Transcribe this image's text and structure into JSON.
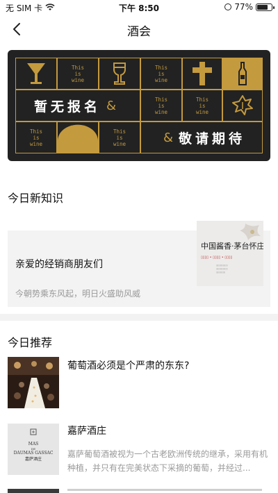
{
  "status_bar": {
    "carrier": "无 SIM 卡",
    "time": "下午 8:50",
    "battery_text": "77%",
    "battery_level": 0.77
  },
  "nav": {
    "title": "酒会"
  },
  "banner": {
    "wine_text": "This\nis\nwine",
    "left_text": "暂无报名",
    "right_text": "敬请期待",
    "amp": "&",
    "gold": "#c49a3e",
    "bg": "#222222"
  },
  "knowledge": {
    "section_title": "今日新知识",
    "card": {
      "headline": "亲爱的经销商朋友们",
      "subtitle": "今朝势乘东风起，明日火盛助风威",
      "thumb_title": "中国酱香·茅台怀庄"
    }
  },
  "recommend": {
    "section_title": "今日推荐",
    "items": [
      {
        "title": "葡萄酒必须是个严肃的东东?",
        "desc": ""
      },
      {
        "title": "嘉萨酒庄",
        "desc": "嘉萨葡萄酒被视为一个古老欧洲传统的继承，采用有机种植，并只有在完美状态下采摘的葡萄，并经过...",
        "logo_line1": "MAS",
        "logo_line2": "DE",
        "logo_line3": "DAUMAS GASSAC",
        "logo_line4": "嘉萨酒庄"
      }
    ]
  }
}
